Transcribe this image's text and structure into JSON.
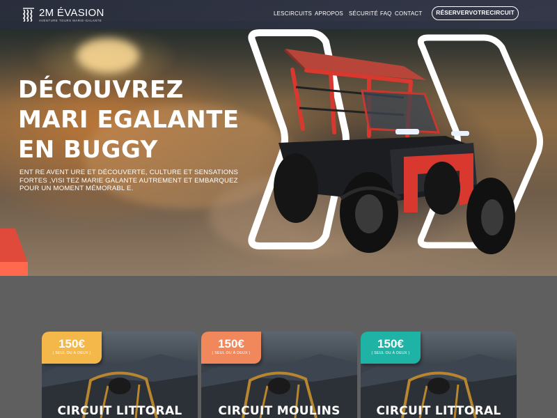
{
  "colors": {
    "header_bg": "#2d3140",
    "section_bg": "#5f5f5f",
    "accent_red": "#e04a3a",
    "card1_tab": "#f4b74a",
    "card2_tab": "#f0885c",
    "card3_tab": "#1fb3a6"
  },
  "header": {
    "logo_icon": "palm-waves-logo-icon",
    "logo_name": "2M ÉVASION",
    "logo_tagline": "Aventure tours marie-galante",
    "nav": [
      "LesCircuits",
      "Apropos",
      "Sécurité",
      "FAQ",
      "Contact"
    ],
    "cta_label": "RéserverVotreCircuit"
  },
  "hero": {
    "title_lines": [
      "DÉCOUVREZ",
      "MARI EGALANTE",
      "EN BUGGY"
    ],
    "description": "ENT RE AVENT URE ET  DÉCOUVERTE, CULTURE ET SENSATIONS FORTES ,VISI TEZ  MARIE GALANTE  AUTREMENT ET EMBARQUEZ POUR UN MOMENT MÉMORABL E."
  },
  "cards": [
    {
      "price": "150€",
      "price_note": "( SEUL OU À DEUX )",
      "title": "CIRCUIT LITTORAL"
    },
    {
      "price": "150€",
      "price_note": "( SEUL OU À DEUX )",
      "title": "CIRCUIT MOULINS"
    },
    {
      "price": "150€",
      "price_note": "( SEUL OU À DEUX )",
      "title": "CIRCUIT LITTORAL"
    }
  ]
}
